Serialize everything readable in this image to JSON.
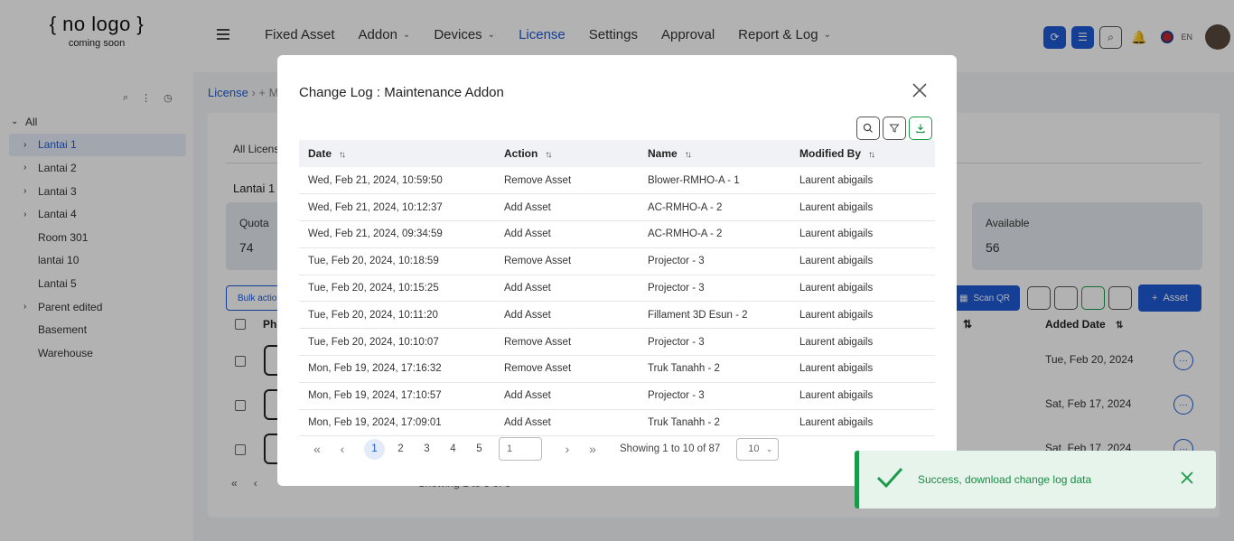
{
  "logo": {
    "line1": "{ no logo }",
    "line2": "coming soon"
  },
  "nav": [
    {
      "label": "Fixed Asset",
      "dropdown": false,
      "active": false
    },
    {
      "label": "Addon",
      "dropdown": true,
      "active": false
    },
    {
      "label": "Devices",
      "dropdown": true,
      "active": false
    },
    {
      "label": "License",
      "dropdown": false,
      "active": true
    },
    {
      "label": "Settings",
      "dropdown": false,
      "active": false
    },
    {
      "label": "Approval",
      "dropdown": false,
      "active": false
    },
    {
      "label": "Report & Log",
      "dropdown": true,
      "active": false
    }
  ],
  "topbar": {
    "lang": "EN"
  },
  "sidebar": {
    "root": "All",
    "items": [
      {
        "label": "Lantai 1",
        "caret": true,
        "active": true
      },
      {
        "label": "Lantai 2",
        "caret": true,
        "active": false
      },
      {
        "label": "Lantai 3",
        "caret": true,
        "active": false
      },
      {
        "label": "Lantai 4",
        "caret": true,
        "active": false
      },
      {
        "label": "Room 301",
        "caret": false,
        "active": false
      },
      {
        "label": "lantai 10",
        "caret": false,
        "active": false
      },
      {
        "label": "Lantai 5",
        "caret": false,
        "active": false
      },
      {
        "label": "Parent edited",
        "caret": true,
        "active": false
      },
      {
        "label": "Basement",
        "caret": false,
        "active": false
      },
      {
        "label": "Warehouse",
        "caret": false,
        "active": false
      }
    ]
  },
  "background": {
    "breadcrumb": "License",
    "breadcrumb_rest": "+ M",
    "tab_label": "All Licens",
    "section_title": "Lantai 1",
    "quota_label": "Quota",
    "quota_value": "74",
    "available_label": "Available",
    "available_value": "56",
    "bulk_label": "Bulk action",
    "scan_qr_label": "Scan QR",
    "add_asset_label": "Asset",
    "photo_header": "Pho",
    "added_date_header": "Added Date",
    "rows": [
      {
        "added_date": "Tue, Feb 20, 2024"
      },
      {
        "added_date": "Sat, Feb 17, 2024"
      },
      {
        "added_date": "Sat, Feb 17, 2024"
      }
    ],
    "pager_text": "Showing 1 to 3 of 3"
  },
  "modal": {
    "title": "Change Log : Maintenance Addon",
    "columns": [
      "Date",
      "Action",
      "Name",
      "Modified By"
    ],
    "rows": [
      {
        "date": "Wed, Feb 21, 2024, 10:59:50",
        "action": "Remove Asset",
        "name": "Blower-RMHO-A - 1",
        "modified_by": "Laurent abigails"
      },
      {
        "date": "Wed, Feb 21, 2024, 10:12:37",
        "action": "Add Asset",
        "name": "AC-RMHO-A - 2",
        "modified_by": "Laurent abigails"
      },
      {
        "date": "Wed, Feb 21, 2024, 09:34:59",
        "action": "Add Asset",
        "name": "AC-RMHO-A - 2",
        "modified_by": "Laurent abigails"
      },
      {
        "date": "Tue, Feb 20, 2024, 10:18:59",
        "action": "Remove Asset",
        "name": "Projector - 3",
        "modified_by": "Laurent abigails"
      },
      {
        "date": "Tue, Feb 20, 2024, 10:15:25",
        "action": "Add Asset",
        "name": "Projector - 3",
        "modified_by": "Laurent abigails"
      },
      {
        "date": "Tue, Feb 20, 2024, 10:11:20",
        "action": "Add Asset",
        "name": "Fillament 3D Esun - 2",
        "modified_by": "Laurent abigails"
      },
      {
        "date": "Tue, Feb 20, 2024, 10:10:07",
        "action": "Remove Asset",
        "name": "Projector - 3",
        "modified_by": "Laurent abigails"
      },
      {
        "date": "Mon, Feb 19, 2024, 17:16:32",
        "action": "Remove Asset",
        "name": "Truk Tanahh - 2",
        "modified_by": "Laurent abigails"
      },
      {
        "date": "Mon, Feb 19, 2024, 17:10:57",
        "action": "Add Asset",
        "name": "Projector - 3",
        "modified_by": "Laurent abigails"
      },
      {
        "date": "Mon, Feb 19, 2024, 17:09:01",
        "action": "Add Asset",
        "name": "Truk Tanahh - 2",
        "modified_by": "Laurent abigails"
      }
    ],
    "pagination": {
      "pages": [
        "1",
        "2",
        "3",
        "4",
        "5"
      ],
      "current": "1",
      "page_input": "1",
      "showing": "Showing 1 to 10 of 87",
      "page_size": "10"
    }
  },
  "toast": {
    "message": "Success, download change log data"
  },
  "colors": {
    "primary": "#1e5bd6",
    "success": "#1b9a4a",
    "toast_bg": "#e6f4ec"
  }
}
